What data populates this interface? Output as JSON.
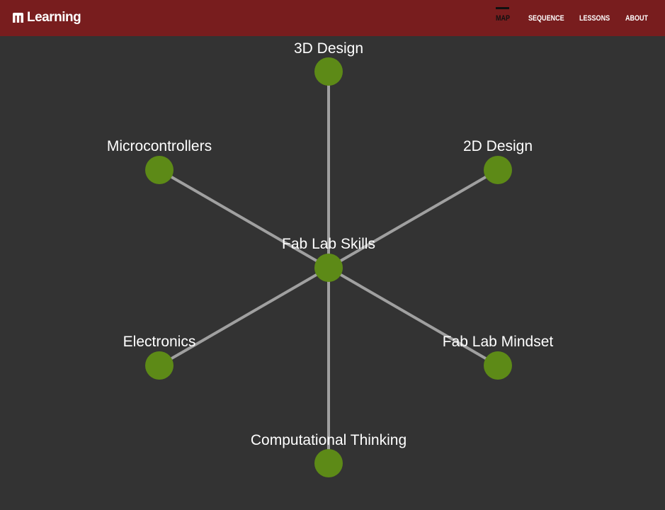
{
  "header": {
    "logo_text": "Learning",
    "logo_icon": "m-logo-icon",
    "brand_color": "#781d1e",
    "nav": [
      {
        "label": "MAP",
        "active": true
      },
      {
        "label": "SEQUENCE",
        "active": false
      },
      {
        "label": "LESSONS",
        "active": false
      },
      {
        "label": "ABOUT",
        "active": false
      }
    ]
  },
  "map": {
    "background": "#333333",
    "node_color": "#5d8a17",
    "edge_color": "#a0a0a0",
    "center": "Fab Lab Skills",
    "nodes": [
      "3D Design",
      "Microcontrollers",
      "2D Design",
      "Fab Lab Skills",
      "Electronics",
      "Fab Lab Mindset",
      "Computational Thinking"
    ]
  }
}
